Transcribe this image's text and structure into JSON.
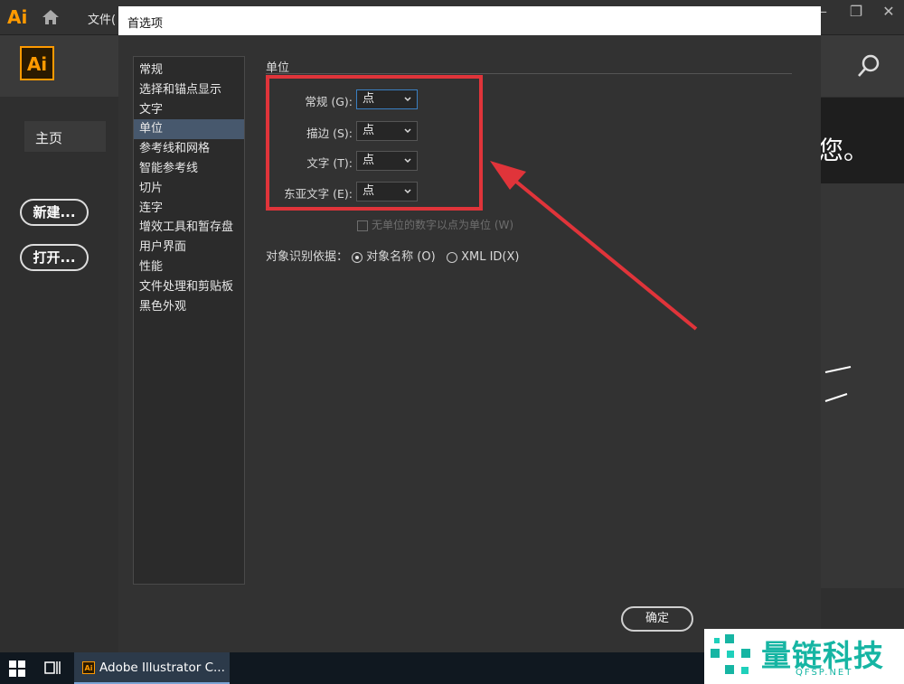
{
  "app": {
    "mini_logo": "Ai",
    "menu_file": "文件(",
    "logo": "Ai",
    "home_tab": "主页",
    "new_button": "新建...",
    "open_button": "打开...",
    "greeting_fragment": "您。"
  },
  "dialog": {
    "title": "首选项",
    "categories": [
      "常规",
      "选择和锚点显示",
      "文字",
      "单位",
      "参考线和网格",
      "智能参考线",
      "切片",
      "连字",
      "增效工具和暂存盘",
      "用户界面",
      "性能",
      "文件处理和剪贴板",
      "黑色外观"
    ],
    "selected_category": "单位",
    "section_title": "单位",
    "units": [
      {
        "label": "常规 (G):",
        "value": "点"
      },
      {
        "label": "描边 (S):",
        "value": "点"
      },
      {
        "label": "文字 (T):",
        "value": "点"
      },
      {
        "label": "东亚文字 (E):",
        "value": "点"
      }
    ],
    "checkbox_label": "无单位的数字以点为单位 (W)",
    "identify_label": "对象识别依据：",
    "radio_name": "对象名称 (O)",
    "radio_xml": "XML ID(X)",
    "ok_button": "确定"
  },
  "annotation": {
    "color": "#e0343a"
  },
  "taskbar": {
    "app_item": "Adobe Illustrator C...",
    "app_icon": "Ai"
  },
  "watermark": {
    "title": "量链科技",
    "subtitle": "QFSP.NET",
    "color": "#16b5a3"
  },
  "colors": {
    "ai_orange": "#ff9a00",
    "selection": "#47586d"
  }
}
